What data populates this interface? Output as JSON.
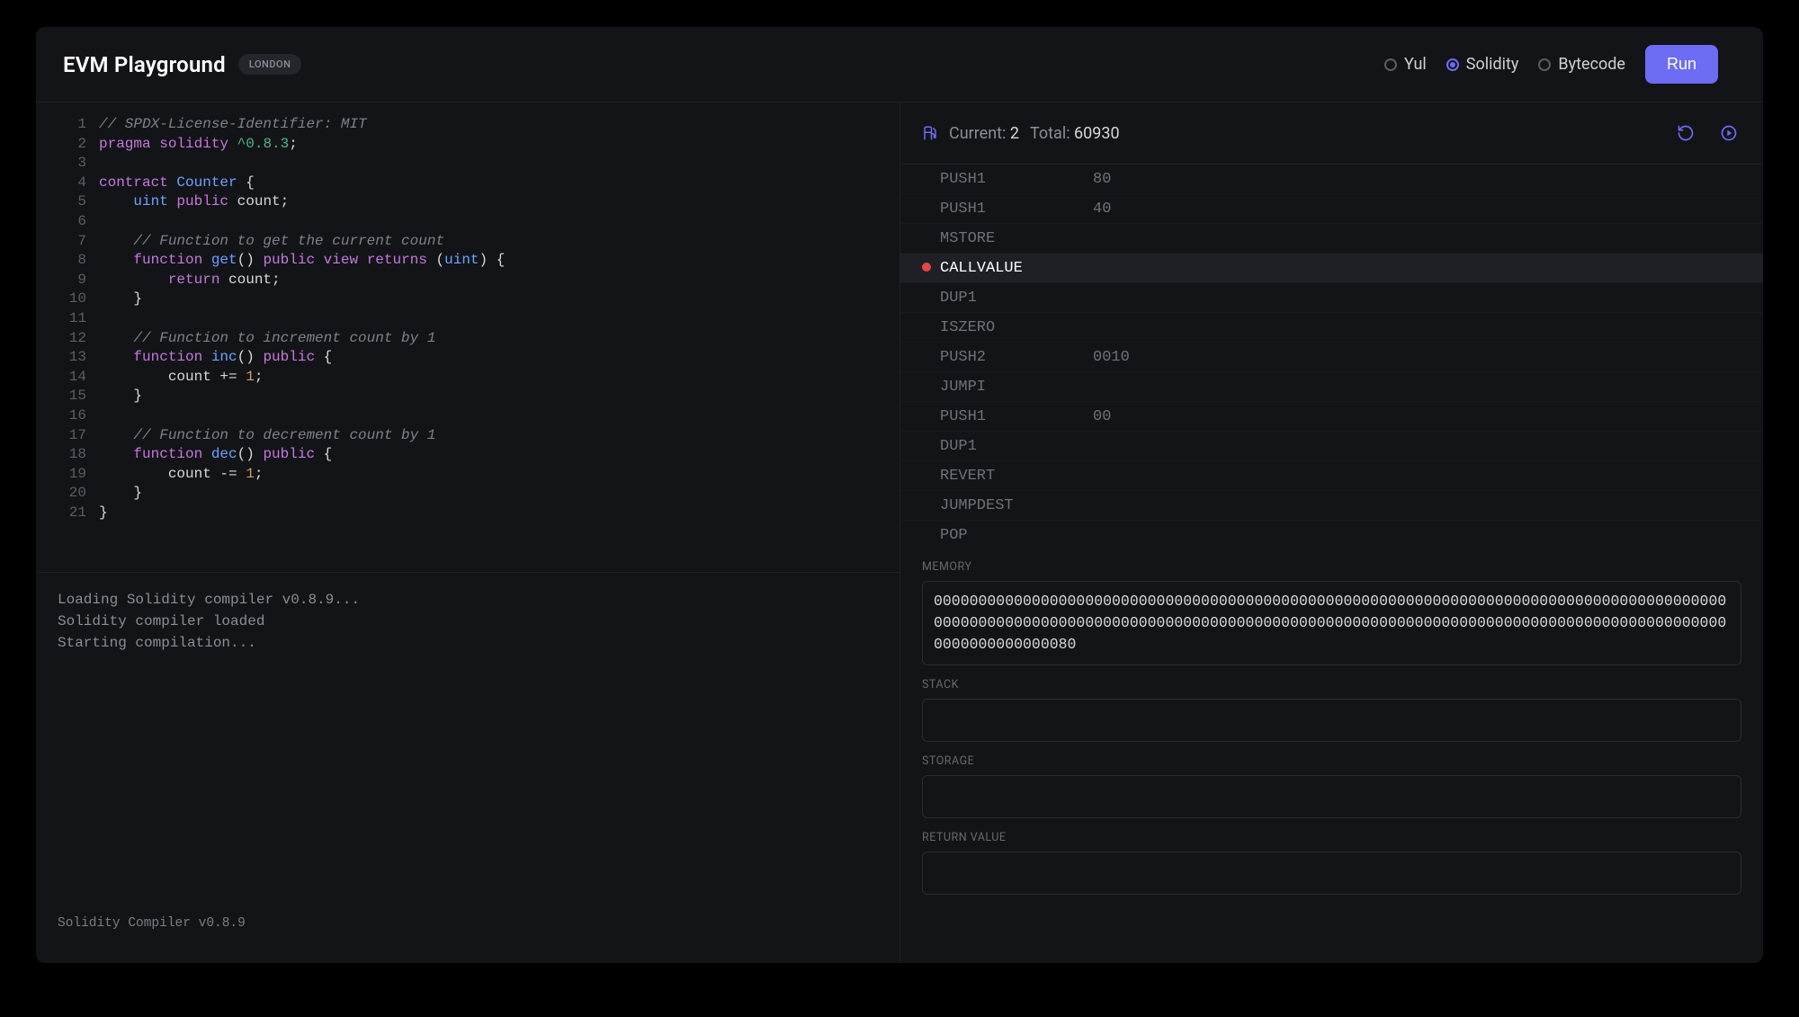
{
  "header": {
    "title": "EVM Playground",
    "badge": "LONDON",
    "run_label": "Run",
    "lang_options": [
      {
        "id": "yul",
        "label": "Yul",
        "selected": false
      },
      {
        "id": "solidity",
        "label": "Solidity",
        "selected": true
      },
      {
        "id": "bytecode",
        "label": "Bytecode",
        "selected": false
      }
    ]
  },
  "gas": {
    "current_label": "Current:",
    "current_value": "2",
    "total_label": "Total:",
    "total_value": "60930"
  },
  "code": {
    "lines": [
      {
        "n": 1,
        "t": [
          [
            "comment",
            "// SPDX-License-Identifier: MIT"
          ]
        ]
      },
      {
        "n": 2,
        "t": [
          [
            "kw",
            "pragma"
          ],
          [
            "plain",
            " "
          ],
          [
            "kw",
            "solidity"
          ],
          [
            "plain",
            " "
          ],
          [
            "version",
            "^0.8.3"
          ],
          [
            "punc",
            ";"
          ]
        ]
      },
      {
        "n": 3,
        "t": []
      },
      {
        "n": 4,
        "t": [
          [
            "kw",
            "contract"
          ],
          [
            "plain",
            " "
          ],
          [
            "type",
            "Counter"
          ],
          [
            "plain",
            " "
          ],
          [
            "punc",
            "{"
          ]
        ]
      },
      {
        "n": 5,
        "t": [
          [
            "plain",
            "    "
          ],
          [
            "type",
            "uint"
          ],
          [
            "plain",
            " "
          ],
          [
            "kw",
            "public"
          ],
          [
            "plain",
            " "
          ],
          [
            "plain",
            "count"
          ],
          [
            "punc",
            ";"
          ]
        ]
      },
      {
        "n": 6,
        "t": []
      },
      {
        "n": 7,
        "t": [
          [
            "plain",
            "    "
          ],
          [
            "comment",
            "// Function to get the current count"
          ]
        ]
      },
      {
        "n": 8,
        "t": [
          [
            "plain",
            "    "
          ],
          [
            "kw",
            "function"
          ],
          [
            "plain",
            " "
          ],
          [
            "fn",
            "get"
          ],
          [
            "punc",
            "()"
          ],
          [
            "plain",
            " "
          ],
          [
            "kw",
            "public"
          ],
          [
            "plain",
            " "
          ],
          [
            "kw",
            "view"
          ],
          [
            "plain",
            " "
          ],
          [
            "kw",
            "returns"
          ],
          [
            "plain",
            " "
          ],
          [
            "punc",
            "("
          ],
          [
            "type",
            "uint"
          ],
          [
            "punc",
            ")"
          ],
          [
            "plain",
            " "
          ],
          [
            "punc",
            "{"
          ]
        ]
      },
      {
        "n": 9,
        "t": [
          [
            "plain",
            "        "
          ],
          [
            "kw",
            "return"
          ],
          [
            "plain",
            " count"
          ],
          [
            "punc",
            ";"
          ]
        ]
      },
      {
        "n": 10,
        "t": [
          [
            "plain",
            "    "
          ],
          [
            "punc",
            "}"
          ]
        ]
      },
      {
        "n": 11,
        "t": []
      },
      {
        "n": 12,
        "t": [
          [
            "plain",
            "    "
          ],
          [
            "comment",
            "// Function to increment count by 1"
          ]
        ]
      },
      {
        "n": 13,
        "t": [
          [
            "plain",
            "    "
          ],
          [
            "kw",
            "function"
          ],
          [
            "plain",
            " "
          ],
          [
            "fn",
            "inc"
          ],
          [
            "punc",
            "()"
          ],
          [
            "plain",
            " "
          ],
          [
            "kw",
            "public"
          ],
          [
            "plain",
            " "
          ],
          [
            "punc",
            "{"
          ]
        ]
      },
      {
        "n": 14,
        "t": [
          [
            "plain",
            "        count "
          ],
          [
            "punc",
            "+="
          ],
          [
            "plain",
            " "
          ],
          [
            "num",
            "1"
          ],
          [
            "punc",
            ";"
          ]
        ]
      },
      {
        "n": 15,
        "t": [
          [
            "plain",
            "    "
          ],
          [
            "punc",
            "}"
          ]
        ]
      },
      {
        "n": 16,
        "t": []
      },
      {
        "n": 17,
        "t": [
          [
            "plain",
            "    "
          ],
          [
            "comment",
            "// Function to decrement count by 1"
          ]
        ]
      },
      {
        "n": 18,
        "t": [
          [
            "plain",
            "    "
          ],
          [
            "kw",
            "function"
          ],
          [
            "plain",
            " "
          ],
          [
            "fn",
            "dec"
          ],
          [
            "punc",
            "()"
          ],
          [
            "plain",
            " "
          ],
          [
            "kw",
            "public"
          ],
          [
            "plain",
            " "
          ],
          [
            "punc",
            "{"
          ]
        ]
      },
      {
        "n": 19,
        "t": [
          [
            "plain",
            "        count "
          ],
          [
            "punc",
            "-="
          ],
          [
            "plain",
            " "
          ],
          [
            "num",
            "1"
          ],
          [
            "punc",
            ";"
          ]
        ]
      },
      {
        "n": 20,
        "t": [
          [
            "plain",
            "    "
          ],
          [
            "punc",
            "}"
          ]
        ]
      },
      {
        "n": 21,
        "t": [
          [
            "punc",
            "}"
          ]
        ]
      }
    ]
  },
  "console": {
    "lines": [
      "Loading Solidity compiler v0.8.9...",
      "Solidity compiler loaded",
      "Starting compilation..."
    ],
    "footer": "Solidity Compiler v0.8.9"
  },
  "opcodes": [
    {
      "name": "PUSH1",
      "arg": "80",
      "active": false
    },
    {
      "name": "PUSH1",
      "arg": "40",
      "active": false
    },
    {
      "name": "MSTORE",
      "arg": "",
      "active": false
    },
    {
      "name": "CALLVALUE",
      "arg": "",
      "active": true
    },
    {
      "name": "DUP1",
      "arg": "",
      "active": false
    },
    {
      "name": "ISZERO",
      "arg": "",
      "active": false
    },
    {
      "name": "PUSH2",
      "arg": "0010",
      "active": false
    },
    {
      "name": "JUMPI",
      "arg": "",
      "active": false
    },
    {
      "name": "PUSH1",
      "arg": "00",
      "active": false
    },
    {
      "name": "DUP1",
      "arg": "",
      "active": false
    },
    {
      "name": "REVERT",
      "arg": "",
      "active": false
    },
    {
      "name": "JUMPDEST",
      "arg": "",
      "active": false
    },
    {
      "name": "POP",
      "arg": "",
      "active": false
    }
  ],
  "state": {
    "memory_label": "MEMORY",
    "memory_value": "00000000000000000000000000000000000000000000000000000000000000000000000000000000000000000000000000000000000000000000000000000000000000000000000000000000000000000000000000000000000000000000000080",
    "stack_label": "STACK",
    "stack_value": "",
    "storage_label": "STORAGE",
    "storage_value": "",
    "return_label": "RETURN VALUE",
    "return_value": ""
  }
}
